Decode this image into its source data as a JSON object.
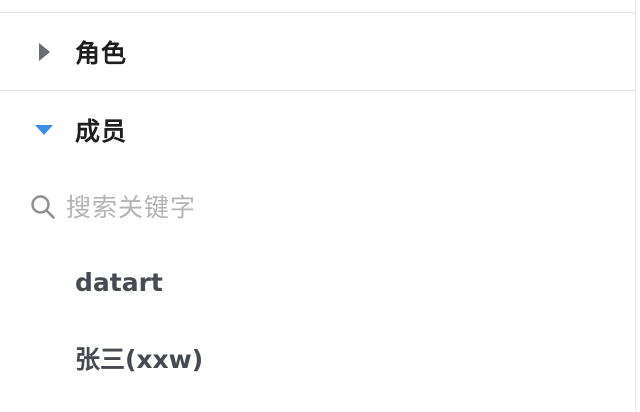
{
  "sections": {
    "roles": {
      "label": "角色",
      "expanded": false,
      "caret_icon": "caret-right-icon",
      "caret_color": "#6b6d72"
    },
    "members": {
      "label": "成员",
      "expanded": true,
      "caret_icon": "caret-down-icon",
      "caret_color": "#3b8fe6",
      "search": {
        "placeholder": "搜索关键字",
        "value": "",
        "icon": "search-icon"
      },
      "items": [
        {
          "label": "datart"
        },
        {
          "label": "张三(xxw)"
        }
      ]
    }
  },
  "colors": {
    "divider": "#e3e3e3",
    "placeholder": "#b4b4b4",
    "member_text": "#474a51",
    "header_text": "#1e1e1e"
  }
}
